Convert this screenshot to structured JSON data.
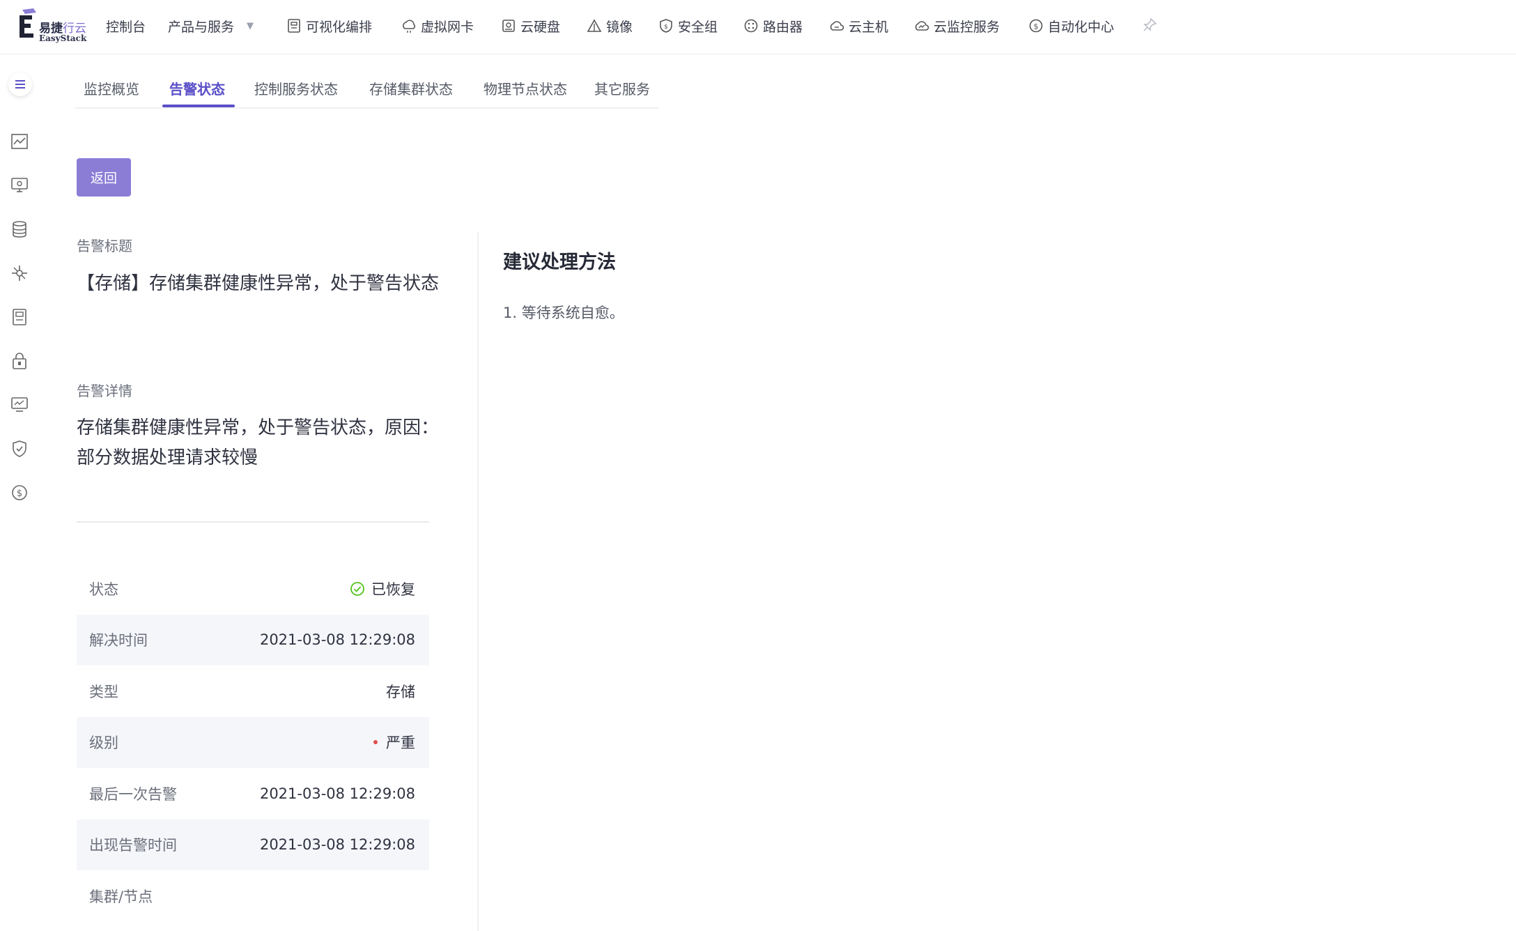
{
  "brand": {
    "name_cn_main": "易捷",
    "name_cn_accent": "行云",
    "name_en": "EasyStack",
    "accent_color": "#5a4fc8"
  },
  "topnav": {
    "items": [
      {
        "label": "控制台",
        "icon": ""
      },
      {
        "label": "产品与服务",
        "icon": ""
      },
      {
        "label": "可视化编排",
        "icon": "orchestration-icon"
      },
      {
        "label": "虚拟网卡",
        "icon": "nic-icon"
      },
      {
        "label": "云硬盘",
        "icon": "disk-icon"
      },
      {
        "label": "镜像",
        "icon": "image-icon"
      },
      {
        "label": "安全组",
        "icon": "security-group-icon"
      },
      {
        "label": "路由器",
        "icon": "router-icon"
      },
      {
        "label": "云主机",
        "icon": "cloud-host-icon"
      },
      {
        "label": "云监控服务",
        "icon": "cloud-monitor-icon"
      },
      {
        "label": "自动化中心",
        "icon": "automation-icon"
      }
    ]
  },
  "tabs": {
    "items": [
      "监控概览",
      "告警状态",
      "控制服务状态",
      "存储集群状态",
      "物理节点状态",
      "其它服务"
    ],
    "active": "告警状态"
  },
  "back_button": {
    "label": "返回"
  },
  "alert": {
    "title_label": "告警标题",
    "title_value": "【存储】存储集群健康性异常，处于警告状态",
    "detail_label": "告警详情",
    "detail_value": "存储集群健康性异常，处于警告状态，原因：部分数据处理请求较慢"
  },
  "info_table": {
    "rows": [
      {
        "key": "状态",
        "value": "已恢复"
      },
      {
        "key": "解决时间",
        "value": "2021-03-08 12:29:08"
      },
      {
        "key": "类型",
        "value": "存储"
      },
      {
        "key": "级别",
        "value": "严重"
      },
      {
        "key": "最后一次告警",
        "value": "2021-03-08 12:29:08"
      },
      {
        "key": "出现告警时间",
        "value": "2021-03-08 12:29:08"
      },
      {
        "key": "集群/节点",
        "value": ""
      }
    ],
    "status_color": "#52c41a",
    "severity_color": "#e34d4d"
  },
  "suggestion": {
    "title": "建议处理方法",
    "items": [
      "1. 等待系统自愈。"
    ]
  }
}
